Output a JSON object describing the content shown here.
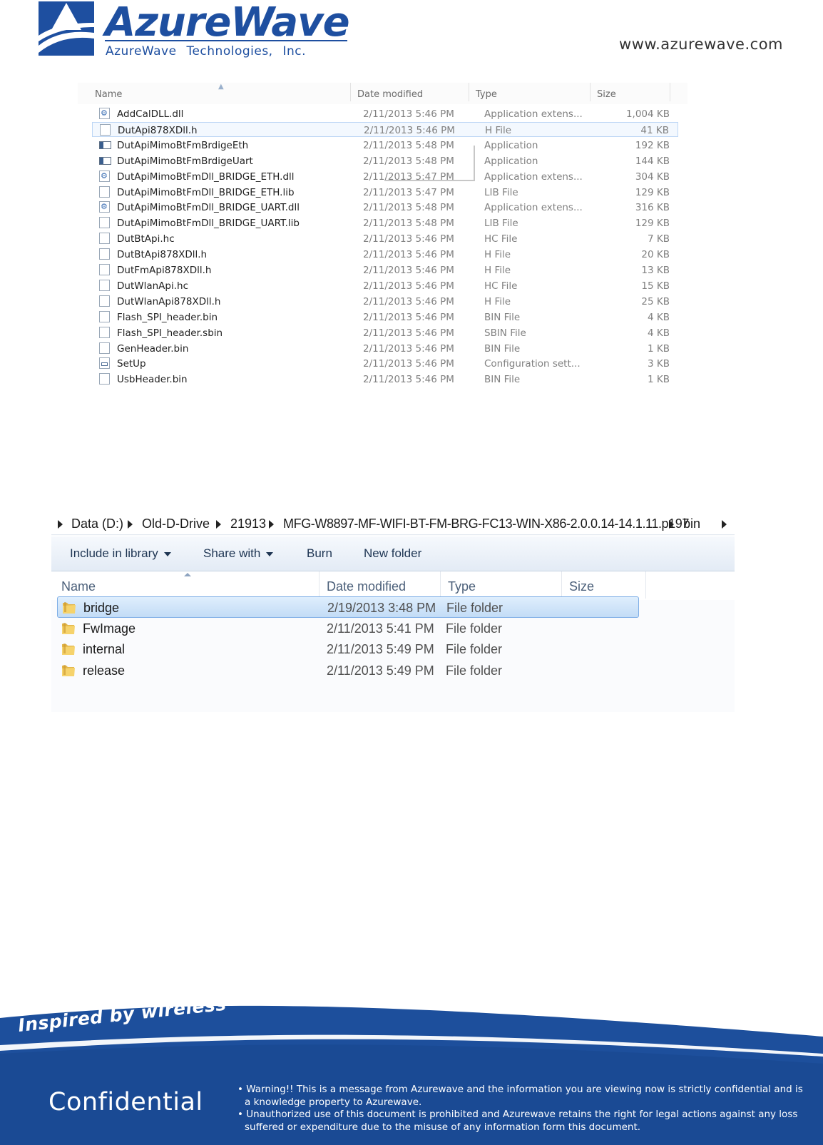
{
  "header": {
    "logo_name": "AzureWave",
    "logo_subtitle": "AzureWave Technologies, Inc.",
    "website": "www.azurewave.com"
  },
  "explorer1": {
    "columns": [
      "Name",
      "Date modified",
      "Type",
      "Size"
    ],
    "selected_index": 1,
    "files": [
      {
        "name": "AddCalDLL.dll",
        "date": "2/11/2013 5:46 PM",
        "type": "Application extens...",
        "size": "1,004 KB",
        "icon": "dll-file-icon"
      },
      {
        "name": "DutApi878XDll.h",
        "date": "2/11/2013 5:46 PM",
        "type": "H File",
        "size": "41 KB",
        "icon": "text-file-icon"
      },
      {
        "name": "DutApiMimoBtFmBrdigeEth",
        "date": "2/11/2013 5:48 PM",
        "type": "Application",
        "size": "192 KB",
        "icon": "application-icon"
      },
      {
        "name": "DutApiMimoBtFmBrdigeUart",
        "date": "2/11/2013 5:48 PM",
        "type": "Application",
        "size": "144 KB",
        "icon": "application-icon"
      },
      {
        "name": "DutApiMimoBtFmDll_BRIDGE_ETH.dll",
        "date": "2/11/2013 5:47 PM",
        "type": "Application extens...",
        "size": "304 KB",
        "icon": "dll-file-icon"
      },
      {
        "name": "DutApiMimoBtFmDll_BRIDGE_ETH.lib",
        "date": "2/11/2013 5:47 PM",
        "type": "LIB File",
        "size": "129 KB",
        "icon": "text-file-icon"
      },
      {
        "name": "DutApiMimoBtFmDll_BRIDGE_UART.dll",
        "date": "2/11/2013 5:48 PM",
        "type": "Application extens...",
        "size": "316 KB",
        "icon": "dll-file-icon"
      },
      {
        "name": "DutApiMimoBtFmDll_BRIDGE_UART.lib",
        "date": "2/11/2013 5:48 PM",
        "type": "LIB File",
        "size": "129 KB",
        "icon": "text-file-icon"
      },
      {
        "name": "DutBtApi.hc",
        "date": "2/11/2013 5:46 PM",
        "type": "HC File",
        "size": "7 KB",
        "icon": "text-file-icon"
      },
      {
        "name": "DutBtApi878XDll.h",
        "date": "2/11/2013 5:46 PM",
        "type": "H File",
        "size": "20 KB",
        "icon": "text-file-icon"
      },
      {
        "name": "DutFmApi878XDll.h",
        "date": "2/11/2013 5:46 PM",
        "type": "H File",
        "size": "13 KB",
        "icon": "text-file-icon"
      },
      {
        "name": "DutWlanApi.hc",
        "date": "2/11/2013 5:46 PM",
        "type": "HC File",
        "size": "15 KB",
        "icon": "text-file-icon"
      },
      {
        "name": "DutWlanApi878XDll.h",
        "date": "2/11/2013 5:46 PM",
        "type": "H File",
        "size": "25 KB",
        "icon": "text-file-icon"
      },
      {
        "name": "Flash_SPI_header.bin",
        "date": "2/11/2013 5:46 PM",
        "type": "BIN File",
        "size": "4 KB",
        "icon": "text-file-icon"
      },
      {
        "name": "Flash_SPI_header.sbin",
        "date": "2/11/2013 5:46 PM",
        "type": "SBIN File",
        "size": "4 KB",
        "icon": "text-file-icon"
      },
      {
        "name": "GenHeader.bin",
        "date": "2/11/2013 5:46 PM",
        "type": "BIN File",
        "size": "1 KB",
        "icon": "text-file-icon"
      },
      {
        "name": "SetUp",
        "date": "2/11/2013 5:46 PM",
        "type": "Configuration sett...",
        "size": "3 KB",
        "icon": "config-file-icon"
      },
      {
        "name": "UsbHeader.bin",
        "date": "2/11/2013 5:46 PM",
        "type": "BIN File",
        "size": "1 KB",
        "icon": "text-file-icon"
      }
    ]
  },
  "explorer2": {
    "breadcrumb": [
      "Data (D:)",
      "Old-D-Drive",
      "21913",
      "MFG-W8897-MF-WIFI-BT-FM-BRG-FC13-WIN-X86-2.0.0.14-14.1.11.p197",
      "bin"
    ],
    "toolbar": {
      "include_in_library": "Include in library",
      "share_with": "Share with",
      "burn": "Burn",
      "new_folder": "New folder"
    },
    "columns": [
      "Name",
      "Date modified",
      "Type",
      "Size"
    ],
    "selected_index": 0,
    "folders": [
      {
        "name": "bridge",
        "date": "2/19/2013 3:48 PM",
        "type": "File folder",
        "icon": "folder-icon"
      },
      {
        "name": "FwImage",
        "date": "2/11/2013 5:41 PM",
        "type": "File folder",
        "icon": "folder-icon"
      },
      {
        "name": "internal",
        "date": "2/11/2013 5:49 PM",
        "type": "File folder",
        "icon": "folder-icon"
      },
      {
        "name": "release",
        "date": "2/11/2013 5:49 PM",
        "type": "File folder",
        "icon": "folder-icon"
      }
    ]
  },
  "footer": {
    "tagline": "Inspired by wireless",
    "confidential": "Confidential",
    "warnings": [
      "• Warning!! This is a message from Azurewave and the information you are viewing now is strictly confidential and is a knowledge property to Azurewave.",
      "• Unauthorized use of this document is prohibited and Azurewave retains the right for legal actions against any loss suffered or expenditure due to the misuse of any information form this document."
    ]
  },
  "colors": {
    "brand_blue": "#1e4fa0",
    "footer_blue": "#1d4f9c",
    "selection_blue": "#c3dcf6"
  }
}
